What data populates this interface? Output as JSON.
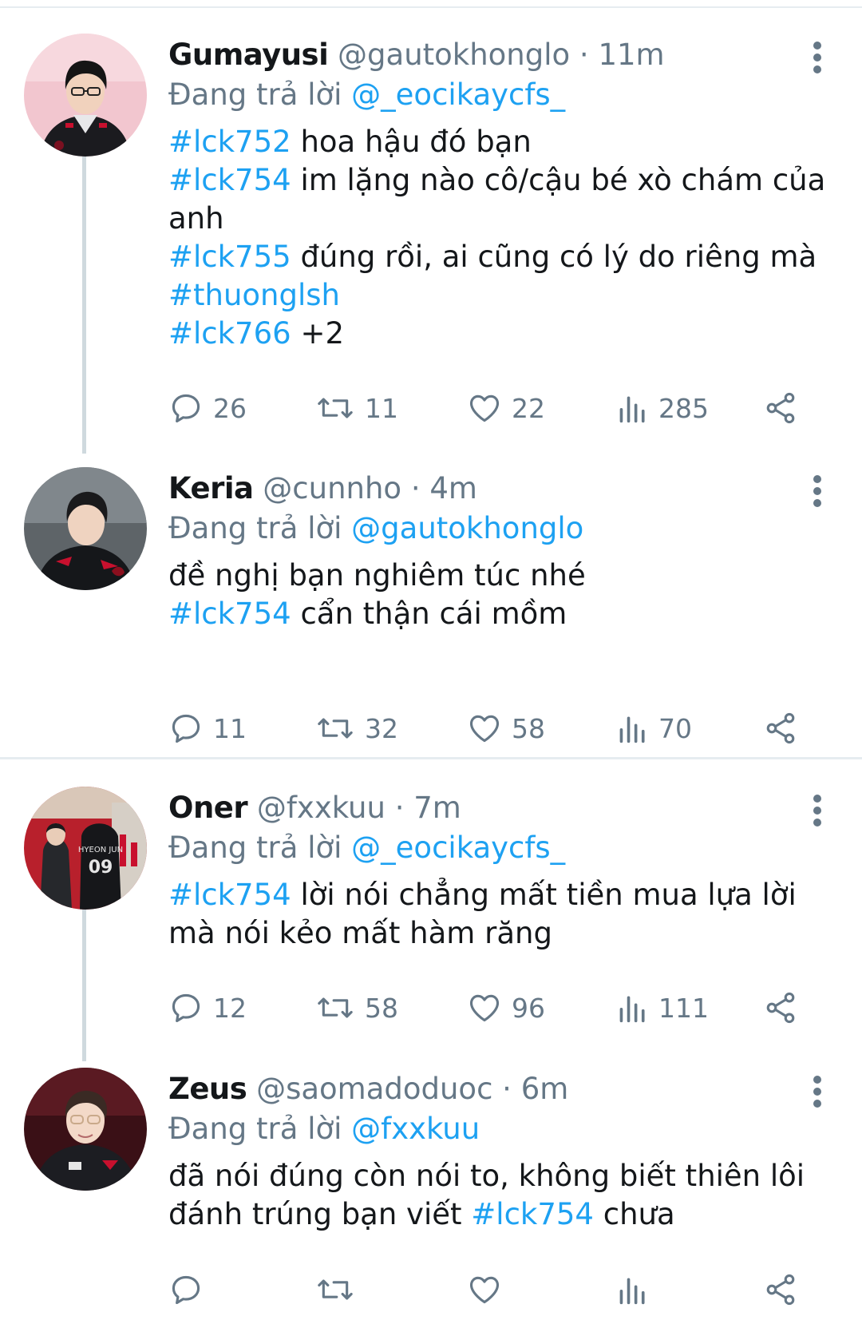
{
  "tweets": [
    {
      "name": "Gumayusi",
      "handle": "@gautokhonglo",
      "time": "· 11m",
      "reply_prefix": "Đang trả lời",
      "reply_to": "@_eocikaycfs_",
      "lines": [
        {
          "tag": "#lck752",
          "text": " hoa hậu đó bạn"
        },
        {
          "tag": "#lck754",
          "text": " im lặng nào cô/cậu bé xò chám của anh"
        },
        {
          "tag": "#lck755",
          "text": " đúng rồi, ai cũng có lý do riêng mà"
        },
        {
          "tag": "#thuonglsh",
          "text": ""
        },
        {
          "tag": "#lck766",
          "text": " +2"
        }
      ],
      "stats": {
        "replies": "26",
        "retweets": "11",
        "likes": "22",
        "views": "285"
      }
    },
    {
      "name": "Keria",
      "handle": "@cunnho",
      "time": "· 4m",
      "reply_prefix": "Đang trả lời",
      "reply_to": "@gautokhonglo",
      "lines": [
        {
          "tag": "",
          "text": "đề nghị bạn nghiêm túc nhé"
        },
        {
          "tag": "#lck754",
          "text": " cẩn thận cái mồm"
        }
      ],
      "stats": {
        "replies": "11",
        "retweets": "32",
        "likes": "58",
        "views": "70"
      }
    },
    {
      "name": "Oner",
      "handle": "@fxxkuu",
      "time": "· 7m",
      "reply_prefix": "Đang trả lời",
      "reply_to": "@_eocikaycfs_",
      "lines": [
        {
          "tag": "#lck754",
          "text": " lời nói chẳng mất tiền mua lựa lời mà nói kẻo mất hàm răng"
        }
      ],
      "stats": {
        "replies": "12",
        "retweets": "58",
        "likes": "96",
        "views": "111"
      }
    },
    {
      "name": "Zeus",
      "handle": "@saomadoduoc",
      "time": "· 6m",
      "reply_prefix": "Đang trả lời",
      "reply_to": "@fxxkuu",
      "line_before": "đã nói đúng còn nói to, không biết thiên lôi đánh trúng bạn viết ",
      "line_tag": "#lck754",
      "line_after": " chưa",
      "stats": {
        "replies": "",
        "retweets": "",
        "likes": "",
        "views": ""
      }
    }
  ],
  "colors": {
    "accent": "#1da1f2",
    "secondary_text": "#657786",
    "primary_text": "#14171a",
    "thread_line": "#cfd9de",
    "divider": "#e6ecf0"
  },
  "icons": {
    "reply": "reply-icon",
    "retweet": "retweet-icon",
    "like": "heart-icon",
    "views": "views-icon",
    "share": "share-icon",
    "more": "more-vertical-icon"
  }
}
